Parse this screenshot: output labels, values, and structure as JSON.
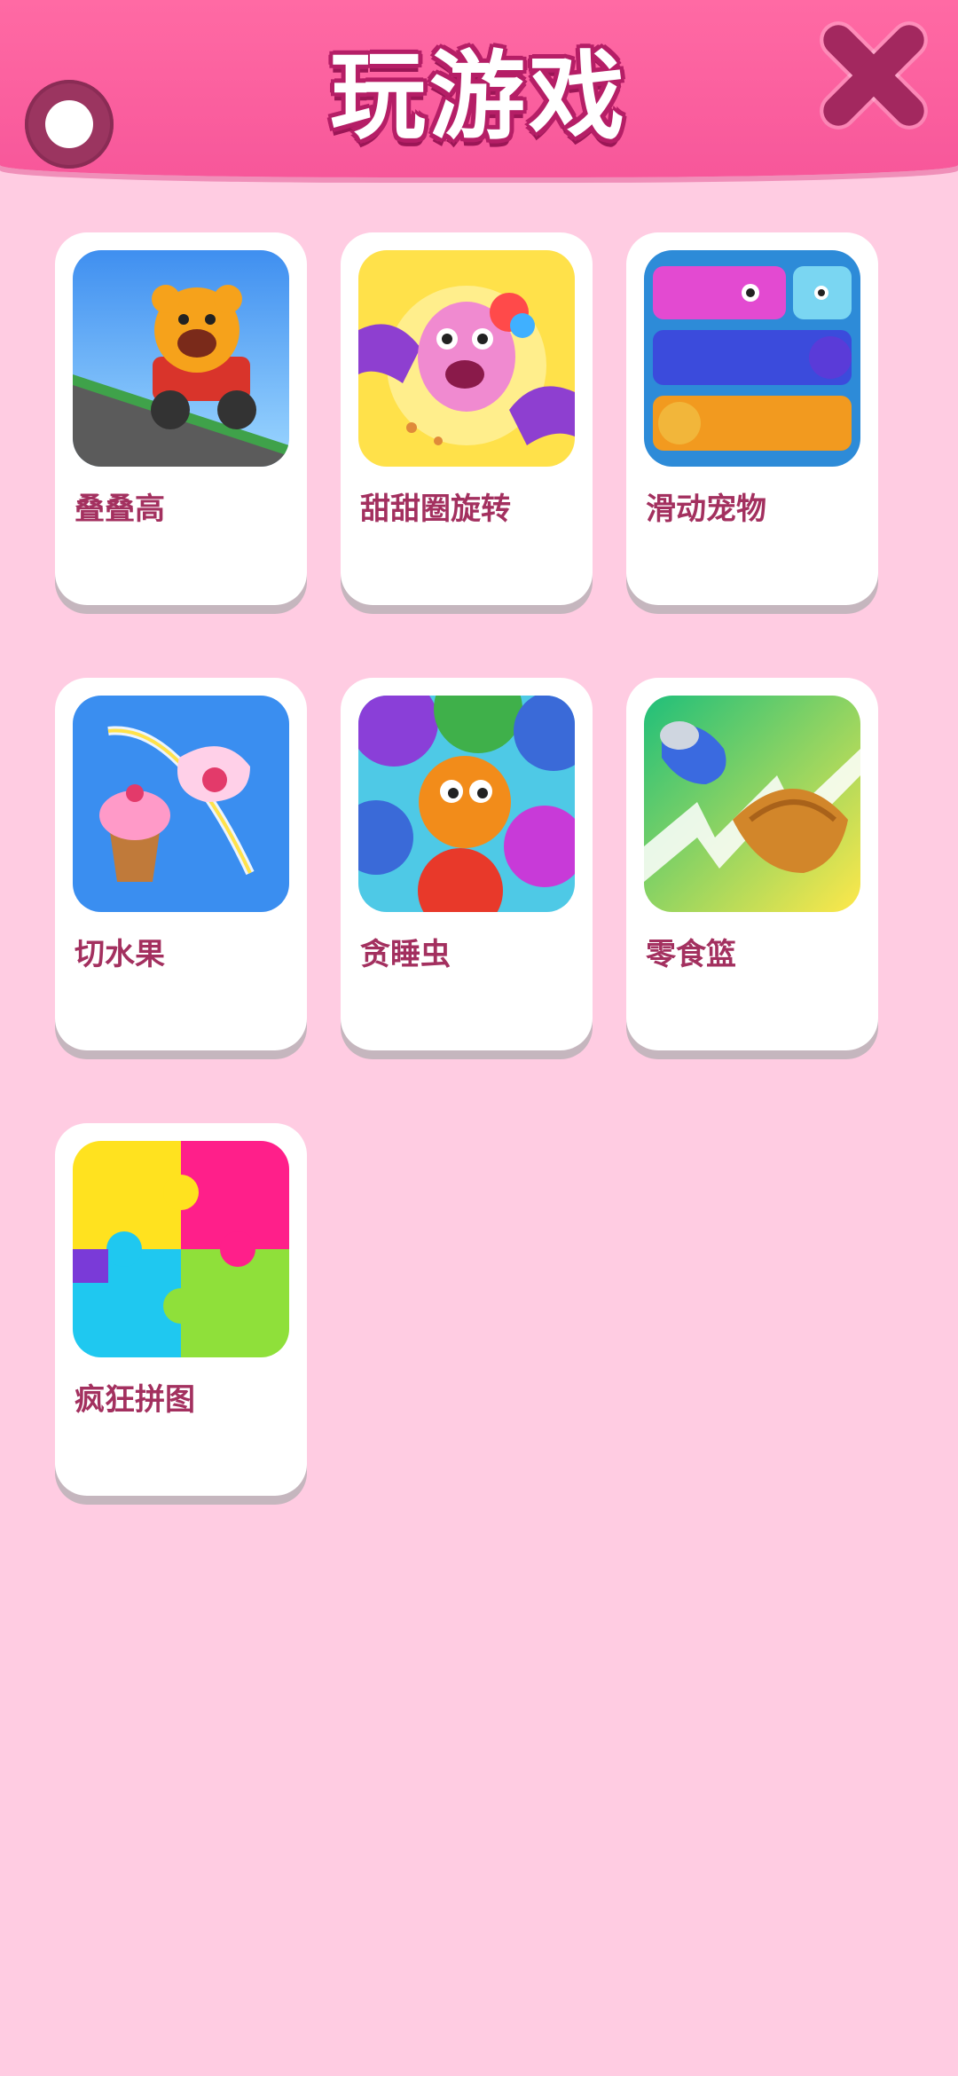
{
  "header": {
    "title": "玩游戏",
    "toggle_icon": "toggle-icon",
    "close_icon": "close-icon",
    "accent": "#f7579a",
    "close_color": "#a3285f"
  },
  "games": [
    {
      "label": "叠叠高",
      "icon": "kart-hamster-icon"
    },
    {
      "label": "甜甜圈旋转",
      "icon": "pink-unicorn-icon"
    },
    {
      "label": "滑动宠物",
      "icon": "sliding-pets-icon"
    },
    {
      "label": "切水果",
      "icon": "cut-icecream-icon"
    },
    {
      "label": "贪睡虫",
      "icon": "sleepy-bugs-icon"
    },
    {
      "label": "零食篮",
      "icon": "snack-basket-icon"
    },
    {
      "label": "疯狂拼图",
      "icon": "puzzle-pieces-icon"
    }
  ]
}
